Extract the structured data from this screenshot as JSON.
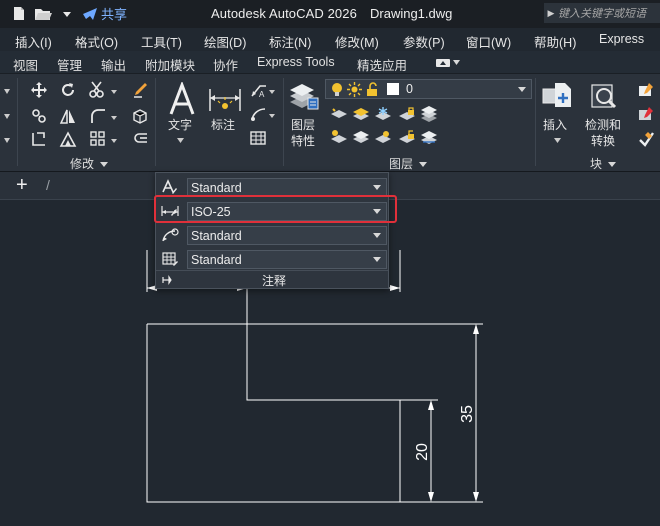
{
  "titlebar": {
    "share_label": "共享",
    "app_name": "Autodesk AutoCAD 2026",
    "doc_name": "Drawing1.dwg",
    "search_placeholder": "键入关键字或短语"
  },
  "menu": [
    "插入(I)",
    "格式(O)",
    "工具(T)",
    "绘图(D)",
    "标注(N)",
    "修改(M)",
    "参数(P)",
    "窗口(W)",
    "帮助(H)",
    "Express"
  ],
  "ribbon_tabs": [
    "视图",
    "管理",
    "输出",
    "附加模块",
    "协作",
    "Express Tools",
    "精选应用"
  ],
  "ribbon": {
    "modify_panel": "修改",
    "text_button": "文字",
    "dimension_button": "标注",
    "layer_props_line1": "图层",
    "layer_props_line2": "特性",
    "layer_current": "0",
    "layer_panel": "图层",
    "insert_button": "插入",
    "measure_line1": "检测和",
    "measure_line2": "转换",
    "block_panel": "块"
  },
  "annotation_panel": {
    "text_style": "Standard",
    "dim_style": "ISO-25",
    "leader_style": "Standard",
    "table_style": "Standard",
    "panel_label": "注释"
  },
  "drawing": {
    "dim_vertical_1": "20",
    "dim_vertical_2": "35"
  },
  "colors": {
    "highlight": "#e0303a",
    "share_blue": "#7fb3ff",
    "bulb_yellow": "#f2c230"
  }
}
